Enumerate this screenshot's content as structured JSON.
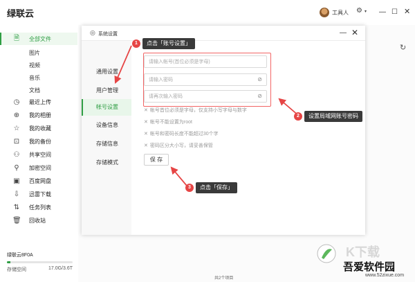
{
  "app": {
    "title": "绿联云",
    "user_name": "工具人"
  },
  "sidebar": {
    "items": [
      {
        "label": "全部文件",
        "icon": "file-icon",
        "active": true
      },
      {
        "label": "最近上传",
        "icon": "clock-icon"
      },
      {
        "label": "我的相册",
        "icon": "album-icon"
      },
      {
        "label": "我的收藏",
        "icon": "star-icon"
      },
      {
        "label": "我的备份",
        "icon": "backup-icon"
      },
      {
        "label": "共享空间",
        "icon": "share-users-icon"
      },
      {
        "label": "加密空间",
        "icon": "lock-user-icon"
      },
      {
        "label": "百度网盘",
        "icon": "cloud-drive-icon"
      },
      {
        "label": "迅雷下载",
        "icon": "download-icon"
      },
      {
        "label": "任务列表",
        "icon": "transfer-icon"
      },
      {
        "label": "回收站",
        "icon": "trash-icon"
      }
    ],
    "sub_items": [
      "图片",
      "视频",
      "音乐",
      "文档"
    ],
    "storage": {
      "device": "绿联云8F0A",
      "label": "存储空间",
      "used": "17.0G/3.6T",
      "fraction": 0.05
    }
  },
  "main": {
    "footer": "共2个项目"
  },
  "dialog": {
    "title": "系统设置",
    "nav": [
      {
        "label": "通用设置"
      },
      {
        "label": "用户管理"
      },
      {
        "label": "帐号设置",
        "active": true
      },
      {
        "label": "设备信息"
      },
      {
        "label": "存储信息"
      },
      {
        "label": "存储模式"
      }
    ],
    "fields": {
      "account_placeholder": "请输入帐号(首位必须是字母)",
      "password_placeholder": "请输入密码",
      "confirm_placeholder": "请再次输入密码"
    },
    "rules": [
      "帐号首位必须是字母，仅支持小写字母与数字",
      "帐号不能设置为root",
      "帐号和密码长度不能超过30个字",
      "密码区分大小写，请妥善保管"
    ],
    "save_label": "保 存"
  },
  "annotations": {
    "step1": {
      "num": "1",
      "text": "点击「账号设置」"
    },
    "step2": {
      "num": "2",
      "text": "设置局域网账号密码"
    },
    "step3": {
      "num": "3",
      "text": "点击「保存」"
    },
    "color": "#e64545"
  },
  "watermark": {
    "main": "吾爱软件园",
    "url": "www.52zixue.com",
    "faint": "K下载"
  }
}
